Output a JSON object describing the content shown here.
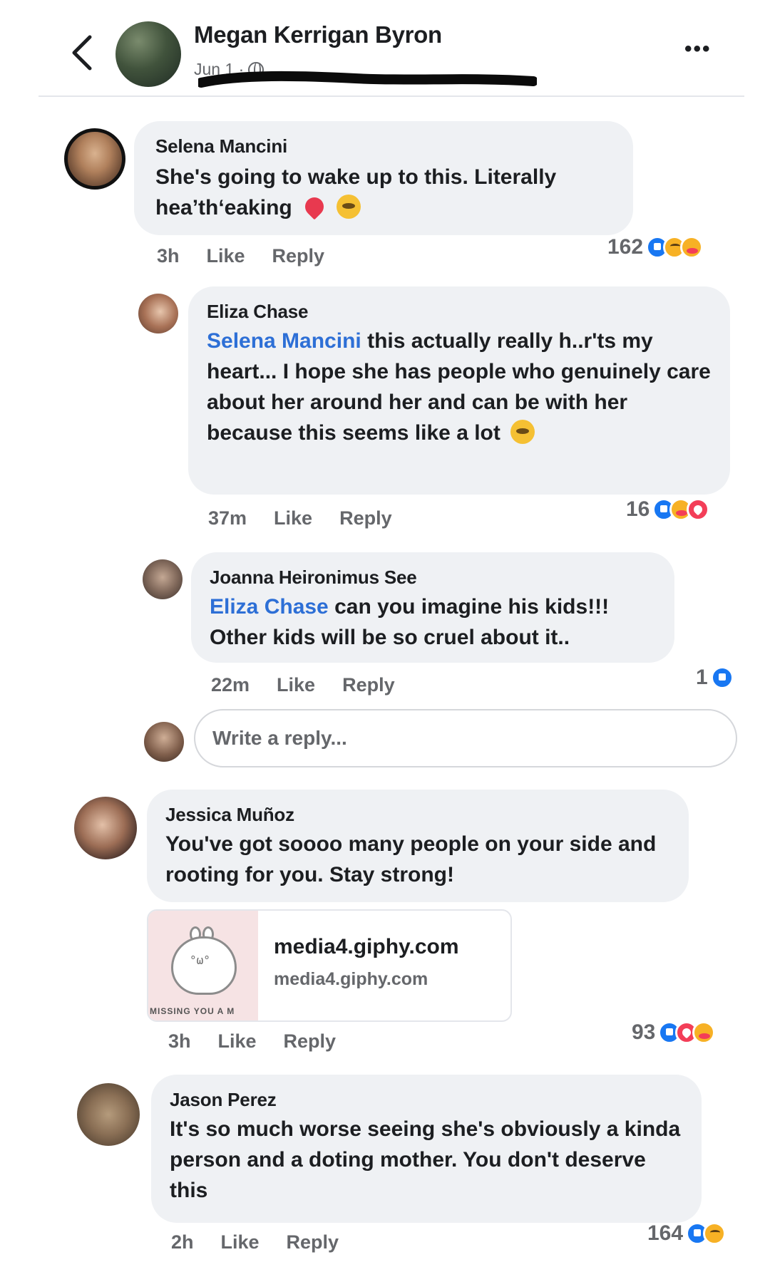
{
  "header": {
    "post_author": "Megan Kerrigan Byron",
    "date": "Jun 1 ·",
    "more_label": "•••"
  },
  "comments": [
    {
      "author": "Selena Mancini",
      "mention": "",
      "text_line1": "She's going to wake up to this. Literally",
      "text_line2": "hea’th‘eaking",
      "time": "3h",
      "like": "Like",
      "reply": "Reply",
      "reaction_count": "162"
    },
    {
      "author": "Eliza Chase",
      "mention": "Selena Mancini",
      "text_line1": " this actually really h..r'ts my",
      "text_rest": "heart... I hope she has people who genuinely care about her around her and can be with her because this seems like a lot",
      "time": "37m",
      "like": "Like",
      "reply": "Reply",
      "reaction_count": "16"
    },
    {
      "author": "Joanna Heironimus See",
      "mention": "Eliza Chase",
      "text_line1": " can you imagine his kids!!!",
      "text_line2": "Other kids will be so cruel about it..",
      "time": "22m",
      "like": "Like",
      "reply": "Reply",
      "reaction_count": "1"
    },
    {
      "author": "Jessica Muñoz",
      "text": "You've got soooo many people on your side and rooting for you. Stay strong!",
      "time": "3h",
      "like": "Like",
      "reply": "Reply",
      "reaction_count": "93",
      "link": {
        "title": "media4.giphy.com",
        "domain": "media4.giphy.com",
        "thumb_caption": "MISSING YOU A M"
      }
    },
    {
      "author": "Jason Perez",
      "text": "It's so much worse seeing she's obviously a kinda person and a doting mother. You don't deserve this",
      "time": "2h",
      "like": "Like",
      "reply": "Reply",
      "reaction_count": "164"
    }
  ],
  "reply_box": {
    "placeholder": "Write a reply..."
  },
  "colors": {
    "like_blue": "#1877f2",
    "love_red": "#f33e58",
    "care_yellow": "#f7b125",
    "mention_blue": "#2d6fd6"
  }
}
